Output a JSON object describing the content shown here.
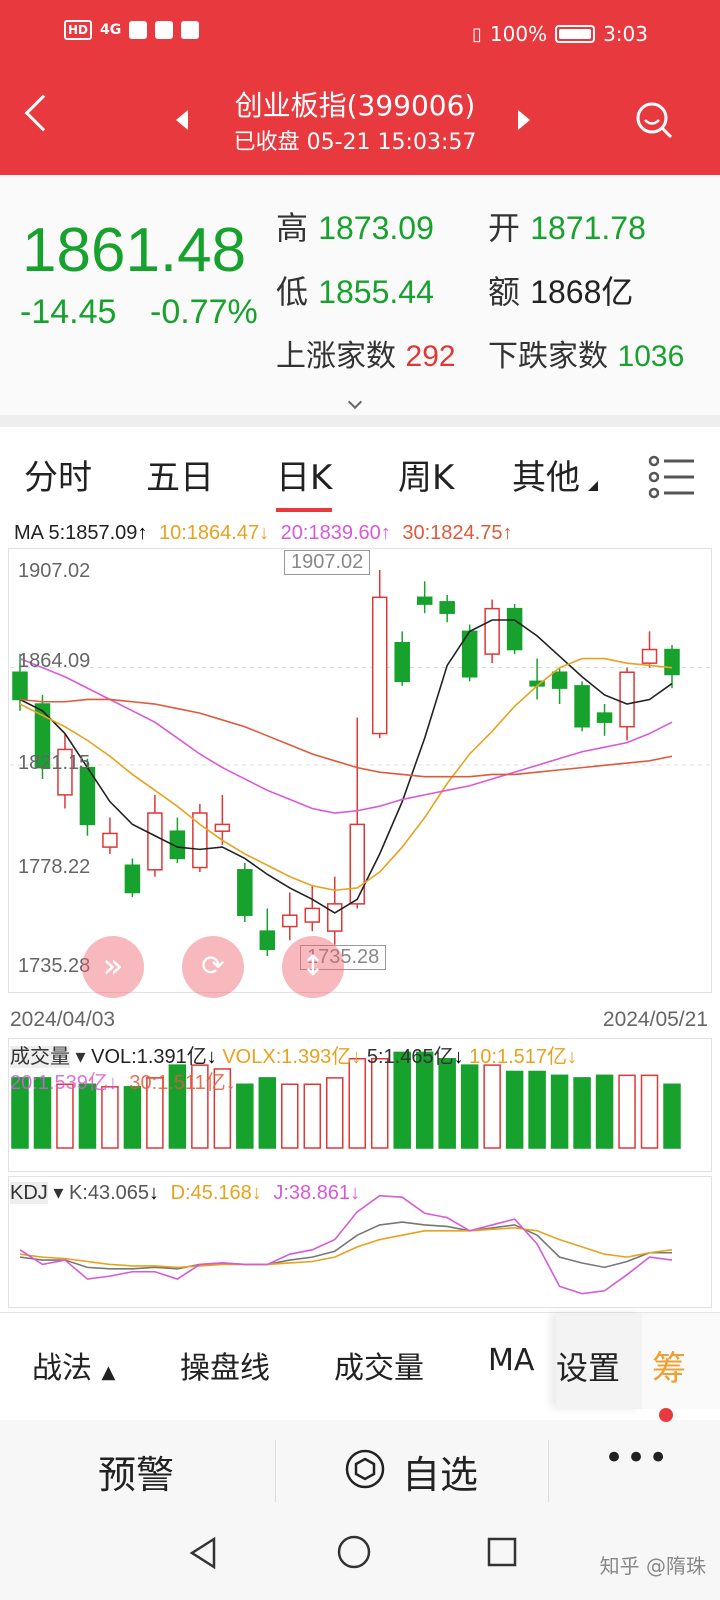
{
  "status_bar": {
    "net_badge": "HD",
    "signal": "4G",
    "battery_pct": "100%",
    "time": "3:03"
  },
  "header": {
    "title": "创业板指(399006)",
    "subtitle": "已收盘  05-21 15:03:57"
  },
  "quote": {
    "price": "1861.48",
    "change": "-14.45",
    "change_pct": "-0.77%",
    "high_label": "高",
    "high": "1873.09",
    "open_label": "开",
    "open": "1871.78",
    "low_label": "低",
    "low": "1855.44",
    "amount_label": "额",
    "amount": "1868亿",
    "up_label": "上涨家数",
    "up_count": "292",
    "down_label": "下跌家数",
    "down_count": "1036"
  },
  "tabs": [
    "分时",
    "五日",
    "日K",
    "周K",
    "其他"
  ],
  "active_tab": "日K",
  "ma": {
    "ma5": "MA 5:1857.09",
    "ma10": "10:1864.47",
    "ma20": "20:1839.60",
    "ma30": "30:1824.75"
  },
  "chart": {
    "y_labels": [
      "1907.02",
      "1864.09",
      "1821.15",
      "1778.22",
      "1735.28"
    ],
    "max_marker": "1907.02",
    "min_marker": "1735.28",
    "start_date": "2024/04/03",
    "end_date": "2024/05/21"
  },
  "volume": {
    "label": "成交量",
    "vol": "VOL:1.391亿",
    "volx": "VOLX:1.393亿",
    "v5": "5:1.465亿",
    "v10": "10:1.517亿",
    "v20": "20:1.539亿",
    "v30": "30:1.511亿"
  },
  "kdj": {
    "label": "KDJ",
    "k": "K:43.065",
    "d": "D:45.168",
    "j": "J:38.861"
  },
  "toolbar": [
    "战法",
    "操盘线",
    "成交量",
    "MA",
    "设置",
    "筹"
  ],
  "bottom_nav": {
    "alert": "预警",
    "watchlist": "自选"
  },
  "watermark": "知乎 @隋珠",
  "colors": {
    "brand_red": "#e8393f",
    "up": "#e03737",
    "down": "#17a12d",
    "ma5": "#222222",
    "ma10": "#e8a21d",
    "ma20": "#d95ad9",
    "ma30": "#e05a3a"
  },
  "chart_data": {
    "type": "candlestick",
    "x_start": "2024/04/03",
    "x_end": "2024/05/21",
    "ylim": [
      1735.28,
      1907.02
    ],
    "candles": [
      {
        "o": 1862,
        "c": 1850,
        "h": 1870,
        "l": 1845
      },
      {
        "o": 1848,
        "c": 1820,
        "h": 1852,
        "l": 1815
      },
      {
        "o": 1808,
        "c": 1828,
        "h": 1835,
        "l": 1802
      },
      {
        "o": 1820,
        "c": 1795,
        "h": 1824,
        "l": 1790
      },
      {
        "o": 1785,
        "c": 1791,
        "h": 1798,
        "l": 1782
      },
      {
        "o": 1777,
        "c": 1765,
        "h": 1780,
        "l": 1763
      },
      {
        "o": 1775,
        "c": 1800,
        "h": 1808,
        "l": 1772
      },
      {
        "o": 1792,
        "c": 1780,
        "h": 1798,
        "l": 1778
      },
      {
        "o": 1776,
        "c": 1800,
        "h": 1804,
        "l": 1774
      },
      {
        "o": 1792,
        "c": 1795,
        "h": 1808,
        "l": 1786
      },
      {
        "o": 1775,
        "c": 1755,
        "h": 1778,
        "l": 1752
      },
      {
        "o": 1748,
        "c": 1740,
        "h": 1758,
        "l": 1737
      },
      {
        "o": 1750,
        "c": 1755,
        "h": 1765,
        "l": 1744
      },
      {
        "o": 1752,
        "c": 1758,
        "h": 1768,
        "l": 1748
      },
      {
        "o": 1748,
        "c": 1760,
        "h": 1772,
        "l": 1742
      },
      {
        "o": 1760,
        "c": 1795,
        "h": 1842,
        "l": 1758
      },
      {
        "o": 1835,
        "c": 1895,
        "h": 1907,
        "l": 1833
      },
      {
        "o": 1875,
        "c": 1858,
        "h": 1880,
        "l": 1856
      },
      {
        "o": 1895,
        "c": 1892,
        "h": 1902,
        "l": 1888
      },
      {
        "o": 1893,
        "c": 1888,
        "h": 1896,
        "l": 1884
      },
      {
        "o": 1880,
        "c": 1860,
        "h": 1883,
        "l": 1858
      },
      {
        "o": 1870,
        "c": 1890,
        "h": 1894,
        "l": 1866
      },
      {
        "o": 1890,
        "c": 1872,
        "h": 1892,
        "l": 1870
      },
      {
        "o": 1858,
        "c": 1856,
        "h": 1868,
        "l": 1850
      },
      {
        "o": 1862,
        "c": 1855,
        "h": 1864,
        "l": 1848
      },
      {
        "o": 1856,
        "c": 1838,
        "h": 1858,
        "l": 1836
      },
      {
        "o": 1844,
        "c": 1840,
        "h": 1848,
        "l": 1834
      },
      {
        "o": 1838,
        "c": 1862,
        "h": 1864,
        "l": 1832
      },
      {
        "o": 1866,
        "c": 1872,
        "h": 1880,
        "l": 1864
      },
      {
        "o": 1872,
        "c": 1861,
        "h": 1874,
        "l": 1855
      }
    ],
    "ma_series": [
      {
        "name": "MA5",
        "values": [
          1850,
          1845,
          1835,
          1820,
          1805,
          1795,
          1790,
          1785,
          1784,
          1785,
          1780,
          1773,
          1767,
          1762,
          1756,
          1762,
          1782,
          1805,
          1833,
          1865,
          1880,
          1885,
          1885,
          1878,
          1869,
          1860,
          1852,
          1848,
          1850,
          1857
        ]
      },
      {
        "name": "MA10",
        "values": [
          1848,
          1843,
          1838,
          1832,
          1825,
          1817,
          1810,
          1803,
          1795,
          1788,
          1782,
          1777,
          1772,
          1768,
          1766,
          1767,
          1774,
          1785,
          1798,
          1813,
          1826,
          1836,
          1847,
          1856,
          1864,
          1868,
          1868,
          1866,
          1865,
          1864
        ]
      },
      {
        "name": "MA20",
        "values": [
          1868,
          1864,
          1860,
          1855,
          1850,
          1845,
          1840,
          1833,
          1826,
          1820,
          1815,
          1810,
          1806,
          1802,
          1800,
          1801,
          1803,
          1806,
          1808,
          1810,
          1812,
          1815,
          1818,
          1821,
          1824,
          1827,
          1829,
          1831,
          1835,
          1840
        ]
      },
      {
        "name": "MA30",
        "values": [
          1850,
          1849,
          1849,
          1850,
          1850,
          1849,
          1848,
          1846,
          1844,
          1841,
          1838,
          1834,
          1830,
          1826,
          1823,
          1820,
          1818,
          1817,
          1816,
          1816,
          1816,
          1817,
          1817,
          1818,
          1819,
          1820,
          1821,
          1822,
          1823,
          1825
        ]
      }
    ],
    "volume_series": [
      0.55,
      0.55,
      0.5,
      0.5,
      0.48,
      0.48,
      0.55,
      0.65,
      0.65,
      0.62,
      0.5,
      0.55,
      0.5,
      0.5,
      0.55,
      0.7,
      0.7,
      0.75,
      0.75,
      0.7,
      0.65,
      0.65,
      0.6,
      0.6,
      0.57,
      0.55,
      0.57,
      0.57,
      0.57,
      0.5
    ],
    "kdj_series": [
      {
        "name": "K",
        "values": [
          40,
          38,
          38,
          33,
          32,
          32,
          33,
          32,
          35,
          36,
          35,
          35,
          38,
          40,
          44,
          55,
          62,
          64,
          62,
          61,
          58,
          60,
          62,
          55,
          40,
          36,
          33,
          37,
          43,
          43
        ]
      },
      {
        "name": "D",
        "values": [
          42,
          40,
          39,
          37,
          35,
          34,
          34,
          33,
          34,
          35,
          35,
          35,
          36,
          37,
          40,
          47,
          52,
          55,
          58,
          58,
          58,
          59,
          60,
          58,
          52,
          47,
          42,
          40,
          43,
          45
        ]
      },
      {
        "name": "J",
        "values": [
          45,
          35,
          38,
          25,
          27,
          30,
          30,
          25,
          35,
          36,
          35,
          35,
          42,
          45,
          52,
          71,
          82,
          81,
          70,
          67,
          58,
          62,
          66,
          49,
          20,
          15,
          17,
          28,
          40,
          38
        ]
      }
    ]
  }
}
